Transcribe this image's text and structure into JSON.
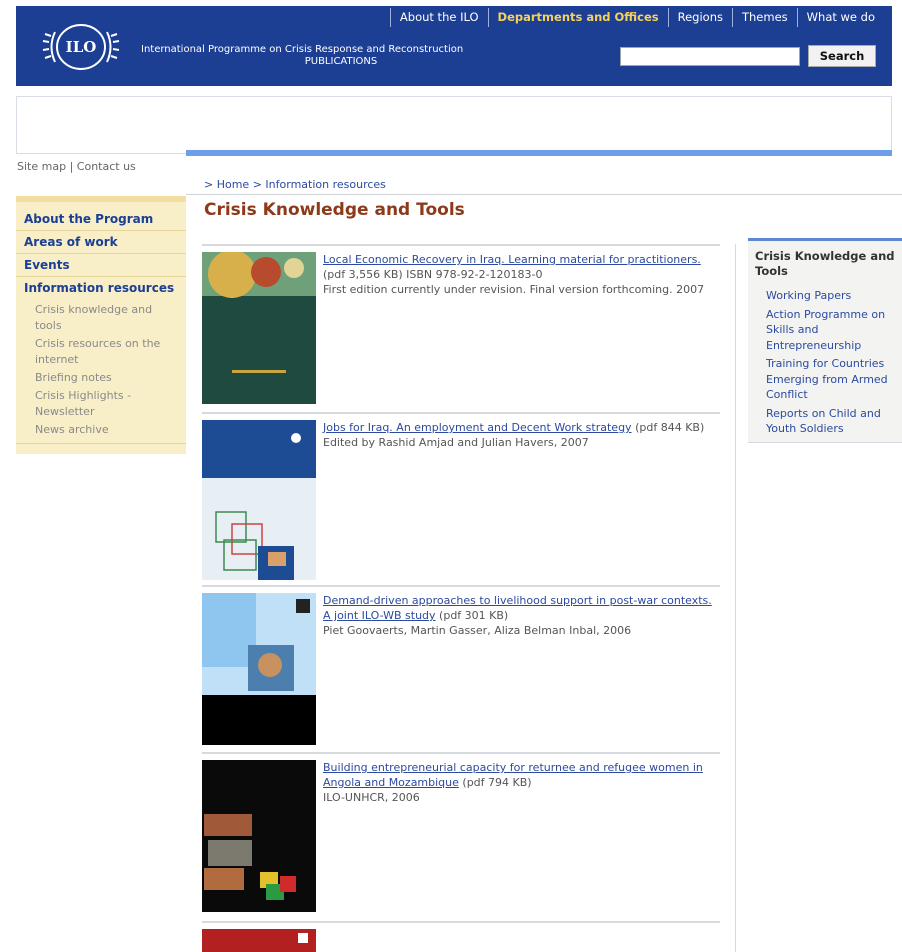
{
  "header": {
    "nav": [
      "About the ILO",
      "Departments and Offices",
      "Regions",
      "Themes",
      "What we do"
    ],
    "logo_text": "ILO",
    "program_line1": "International Programme on Crisis Response and Reconstruction",
    "program_line2": "PUBLICATIONS",
    "search_placeholder": "",
    "search_button": "Search"
  },
  "utility": {
    "sitemap": "Site map",
    "separator": "|",
    "contact": "Contact us"
  },
  "breadcrumb": {
    "prefix": ">",
    "home": "Home",
    "section": "Information resources"
  },
  "page_title": "Crisis Knowledge and Tools",
  "left_nav": {
    "items": [
      "About the Program",
      "Areas of work",
      "Events"
    ],
    "section": "Information resources",
    "subitems": [
      "Crisis knowledge and tools",
      "Crisis resources on the internet",
      "Briefing notes",
      "Crisis Highlights - Newsletter",
      "News archive"
    ]
  },
  "publications": [
    {
      "title": "Local Economic Recovery in Iraq. Learning material for practitioners.",
      "meta": "(pdf 3,556 KB) ISBN 978-92-2-120183-0",
      "details": "First edition currently under revision. Final version forthcoming. 2007"
    },
    {
      "title": "Jobs for Iraq. An employment and Decent Work strategy",
      "meta": "(pdf 844 KB)",
      "details": "Edited by Rashid Amjad and Julian Havers, 2007"
    },
    {
      "title": "Demand-driven approaches to livelihood support in post-war contexts. A joint ILO-WB study",
      "meta": "(pdf 301 KB)",
      "details": "Piet Goovaerts, Martin Gasser, Aliza Belman Inbal, 2006"
    },
    {
      "title": "Building entrepreneurial capacity for returnee and refugee women in Angola and Mozambique",
      "meta": "(pdf 794 KB)",
      "details": "ILO-UNHCR, 2006"
    }
  ],
  "right_box": {
    "title_l1": "Crisis Knowledge and",
    "title_l2": "Tools",
    "links": [
      [
        "Working Papers"
      ],
      [
        "Action Programme on",
        "Skills and",
        "Entrepreneurship"
      ],
      [
        "Training for Countries",
        "Emerging from Armed",
        "Conflict"
      ],
      [
        "Reports on Child and",
        "Youth Soldiers"
      ]
    ]
  },
  "colors": {
    "header": "#1c3f94",
    "accent_yellow": "#f6d25a",
    "title": "#8c3a1a",
    "sidebar": "#f8eec7",
    "link": "#2b4aa0"
  }
}
